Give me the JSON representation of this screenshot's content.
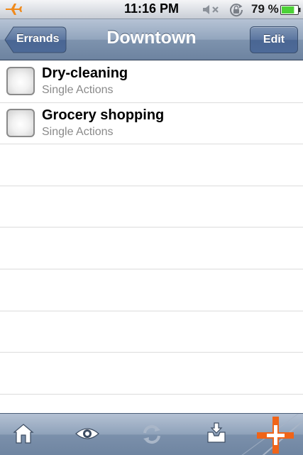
{
  "status_bar": {
    "time": "11:16 PM",
    "battery_percent": "79 %",
    "icons": [
      "airplane-icon",
      "mute-icon",
      "rotation-lock-icon",
      "battery-icon"
    ],
    "battery_level": 0.79,
    "airplane_color": "#f08a1c",
    "battery_color": "#4cd137"
  },
  "nav": {
    "title": "Downtown",
    "back_label": "Errands",
    "edit_label": "Edit"
  },
  "list": {
    "items": [
      {
        "title": "Dry-cleaning",
        "subtitle": "Single Actions"
      },
      {
        "title": "Grocery shopping",
        "subtitle": "Single Actions"
      }
    ]
  },
  "toolbar": {
    "buttons": [
      "home-icon",
      "eye-icon",
      "sync-icon",
      "inbox-icon",
      "add-icon"
    ],
    "accent": "#f06418"
  }
}
